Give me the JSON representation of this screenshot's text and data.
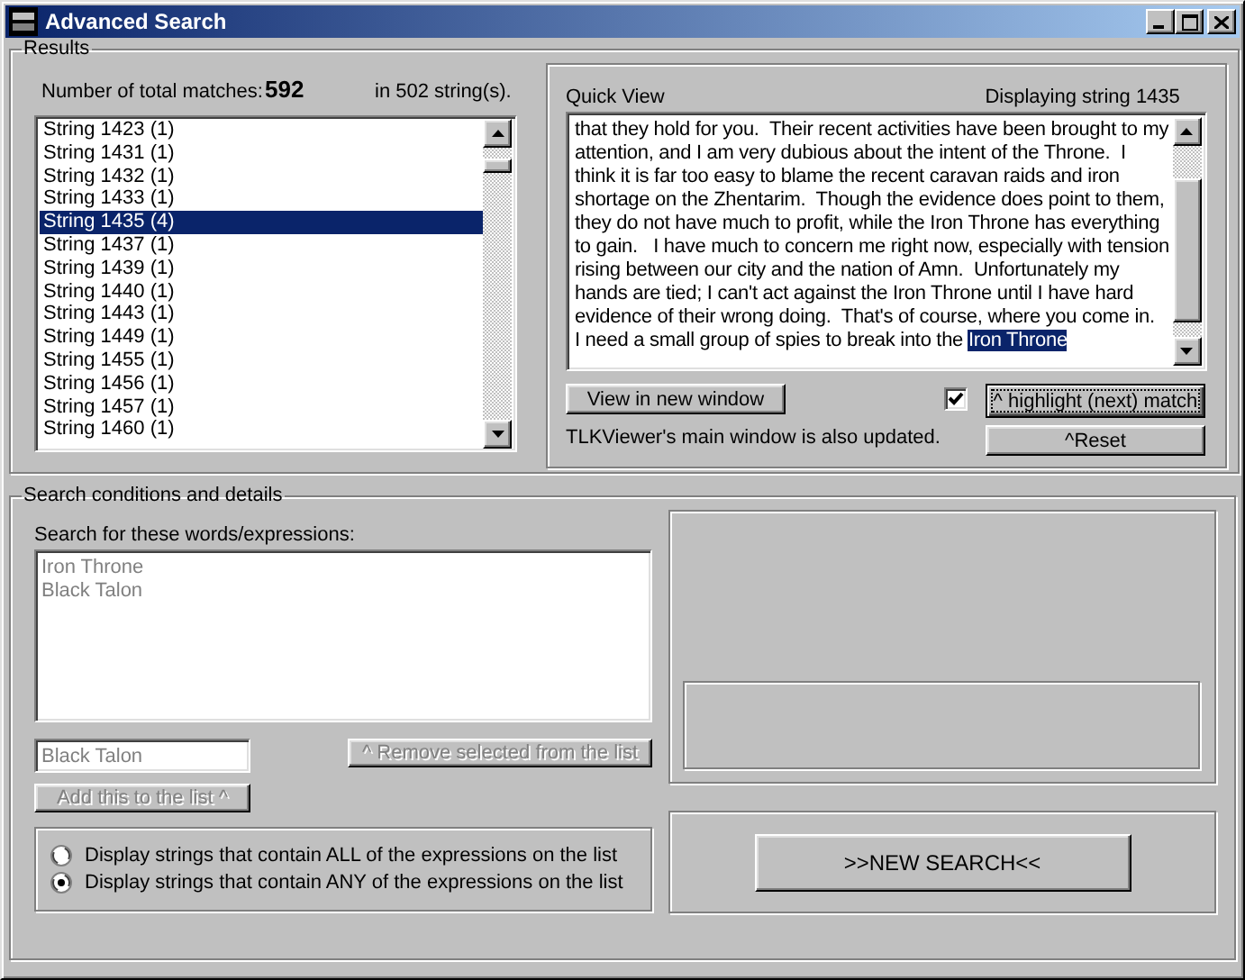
{
  "window": {
    "title": "Advanced Search"
  },
  "results": {
    "legend": "Results",
    "matches_label": "Number of total matches:",
    "matches_count": "592",
    "strings_count": "in 502 string(s).",
    "list": [
      {
        "label": "String 1423 (1)",
        "selected": false
      },
      {
        "label": "String 1431 (1)",
        "selected": false
      },
      {
        "label": "String 1432 (1)",
        "selected": false
      },
      {
        "label": "String 1433 (1)",
        "selected": false
      },
      {
        "label": "String 1435 (4)",
        "selected": true
      },
      {
        "label": "String 1437 (1)",
        "selected": false
      },
      {
        "label": "String 1439 (1)",
        "selected": false
      },
      {
        "label": "String 1440 (1)",
        "selected": false
      },
      {
        "label": "String 1443 (1)",
        "selected": false
      },
      {
        "label": "String 1449 (1)",
        "selected": false
      },
      {
        "label": "String 1455 (1)",
        "selected": false
      },
      {
        "label": "String 1456 (1)",
        "selected": false
      },
      {
        "label": "String 1457 (1)",
        "selected": false
      },
      {
        "label": "String 1460 (1)",
        "selected": false
      }
    ]
  },
  "quick_view": {
    "label": "Quick View",
    "displaying": "Displaying string 1435",
    "lines": [
      {
        "text": "that they hold for you.  Their recent activities have been brought to my"
      },
      {
        "text": "attention, and I am very dubious about the intent of the Throne.  I"
      },
      {
        "text": "think it is far too easy to blame the recent caravan raids and iron"
      },
      {
        "text": "shortage on the Zhentarim.  Though the evidence does point to them,"
      },
      {
        "text": "they do not have much to profit, while the Iron Throne has everything"
      },
      {
        "text": "to gain.   I have much to concern me right now, especially with tension"
      },
      {
        "text": "rising between our city and the nation of Amn.  Unfortunately my"
      },
      {
        "text": "hands are tied; I can't act against the Iron Throne until I have hard"
      },
      {
        "text": "evidence of their wrong doing.  That's of course, where you come in."
      },
      {
        "text": "I need a small group of spies to break into the ",
        "highlight": "Iron Throne"
      }
    ],
    "view_button": "View in new window",
    "highlight_checkbox": {
      "checked": true
    },
    "highlight_button": "^ highlight (next) match",
    "reset_button": "^Reset",
    "note": "TLKViewer's main window is also updated."
  },
  "search": {
    "legend": "Search conditions and details",
    "list_label": "Search for these words/expressions:",
    "expressions_disabled": true,
    "expressions": [
      "Iron Throne",
      "Black Talon"
    ],
    "input": {
      "value": "Black Talon",
      "disabled": true
    },
    "remove_button": {
      "label": "^ Remove selected from the list",
      "disabled": true
    },
    "add_button": {
      "label": "Add this to the list ^",
      "disabled": true
    },
    "options": [
      {
        "label": "Display strings that contain ALL of the expressions on the list",
        "selected": false
      },
      {
        "label": "Display strings that contain ANY of the expressions on the list",
        "selected": true
      }
    ],
    "new_search_button": ">>NEW SEARCH<<"
  }
}
